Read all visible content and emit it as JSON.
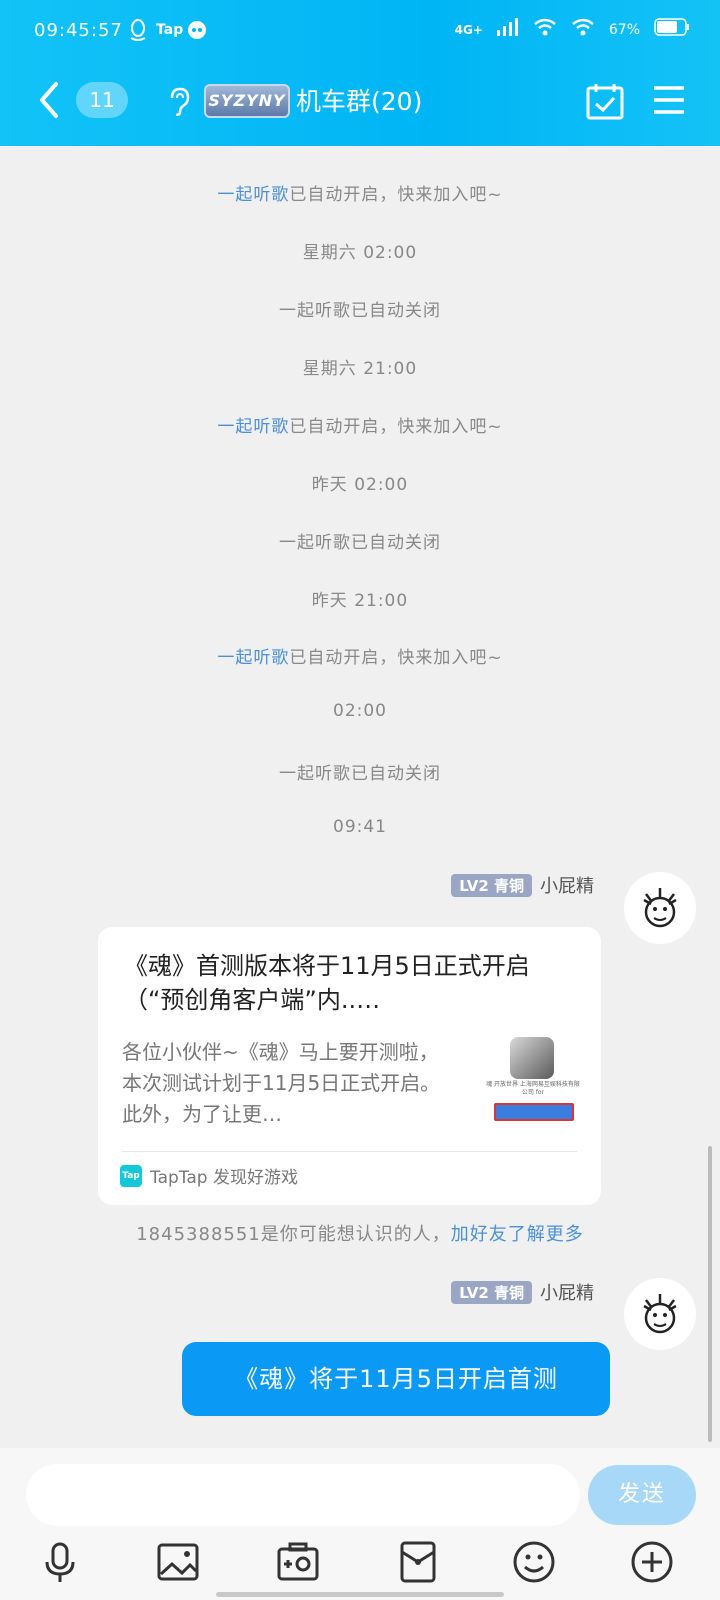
{
  "status_bar": {
    "time": "09:45:57",
    "app_tag": "Tap",
    "network": "4G+",
    "battery": "67%"
  },
  "header": {
    "unread_count": "11",
    "logo_text": "SYZYNY",
    "group_name": "机车群(20)"
  },
  "system_messages": [
    {
      "link": "一起听歌",
      "text": "已自动开启，快来加入吧~"
    },
    {
      "text": "星期六 02:00"
    },
    {
      "text": "一起听歌已自动关闭"
    },
    {
      "text": "星期六 21:00"
    },
    {
      "link": "一起听歌",
      "text": "已自动开启，快来加入吧~"
    },
    {
      "text": "昨天 02:00"
    },
    {
      "text": "一起听歌已自动关闭"
    },
    {
      "text": "昨天 21:00"
    },
    {
      "link": "一起听歌",
      "text": "已自动开启，快来加入吧~"
    },
    {
      "text": "02:00"
    },
    {
      "text": "一起听歌已自动关闭"
    },
    {
      "text": "09:41"
    }
  ],
  "messages": [
    {
      "level": "LV2 青铜",
      "sender": "小屁精",
      "card": {
        "title": "《魂》首测版本将于11月5日正式开启（“预创角客户端”内..…",
        "description": "各位小伙伴~《魂》马上要开测啦，本次测试计划于11月5日正式开启。此外，为了让更…",
        "thumb_text": "魂 开放世界 上海网易互娱科技有限公司 for",
        "source": "TapTap 发现好游戏",
        "source_logo": "Tap"
      }
    },
    {
      "level": "LV2 青铜",
      "sender": "小屁精",
      "text": "《魂》将于11月5日开启首测"
    }
  ],
  "friend_suggestion": {
    "text": "1845388551是你可能想认识的人，",
    "link": "加好友了解更多"
  },
  "input_bar": {
    "send_label": "发送",
    "tools": [
      "microphone-icon",
      "image-icon",
      "camera-icon",
      "red-packet-icon",
      "emoji-icon",
      "plus-icon"
    ]
  },
  "colors": {
    "header": "#00b5f5",
    "bubble": "#0a99f5",
    "link": "#4a90d9",
    "send_disabled": "#a8d8f8"
  }
}
